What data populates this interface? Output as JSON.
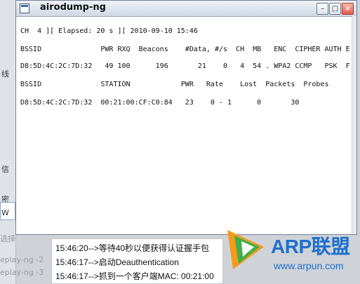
{
  "window": {
    "title": "airodump-ng"
  },
  "terminal": {
    "status_line": "CH  4 ][ Elapsed: 20 s ][ 2010-09-10 15:46",
    "ap_header": "BSSID              PWR RXQ  Beacons    #Data, #/s  CH  MB   ENC  CIPHER AUTH E",
    "ap_row": "D8:5D:4C:2C:7D:32   49 100      196       21    0   4  54 . WPA2 CCMP   PSK  F",
    "station_header": "BSSID              STATION            PWR   Rate    Lost  Packets  Probes",
    "station_row": "D8:5D:4C:2C:7D:32  00:21:00:CF:C0:84   23    0 - 1      0       30"
  },
  "log": [
    "15:46:20-->等待40秒以便获得认证握手包",
    "15:46:17-->启动Deauthentication",
    "15:46:17-->抓到一个客户端MAC: 00:21:00"
  ],
  "background": {
    "left_glyphs": [
      "线",
      "信",
      "密",
      "W"
    ],
    "bottom_left": [
      "选择",
      "eplay-ng -2",
      "eplay-ng -3"
    ]
  },
  "logo": {
    "brand": "ARP联盟",
    "url": "www.arpun.com",
    "colors": {
      "blue": "#1e6fcf",
      "orange": "#f39a1b",
      "green": "#3fb04a"
    }
  }
}
